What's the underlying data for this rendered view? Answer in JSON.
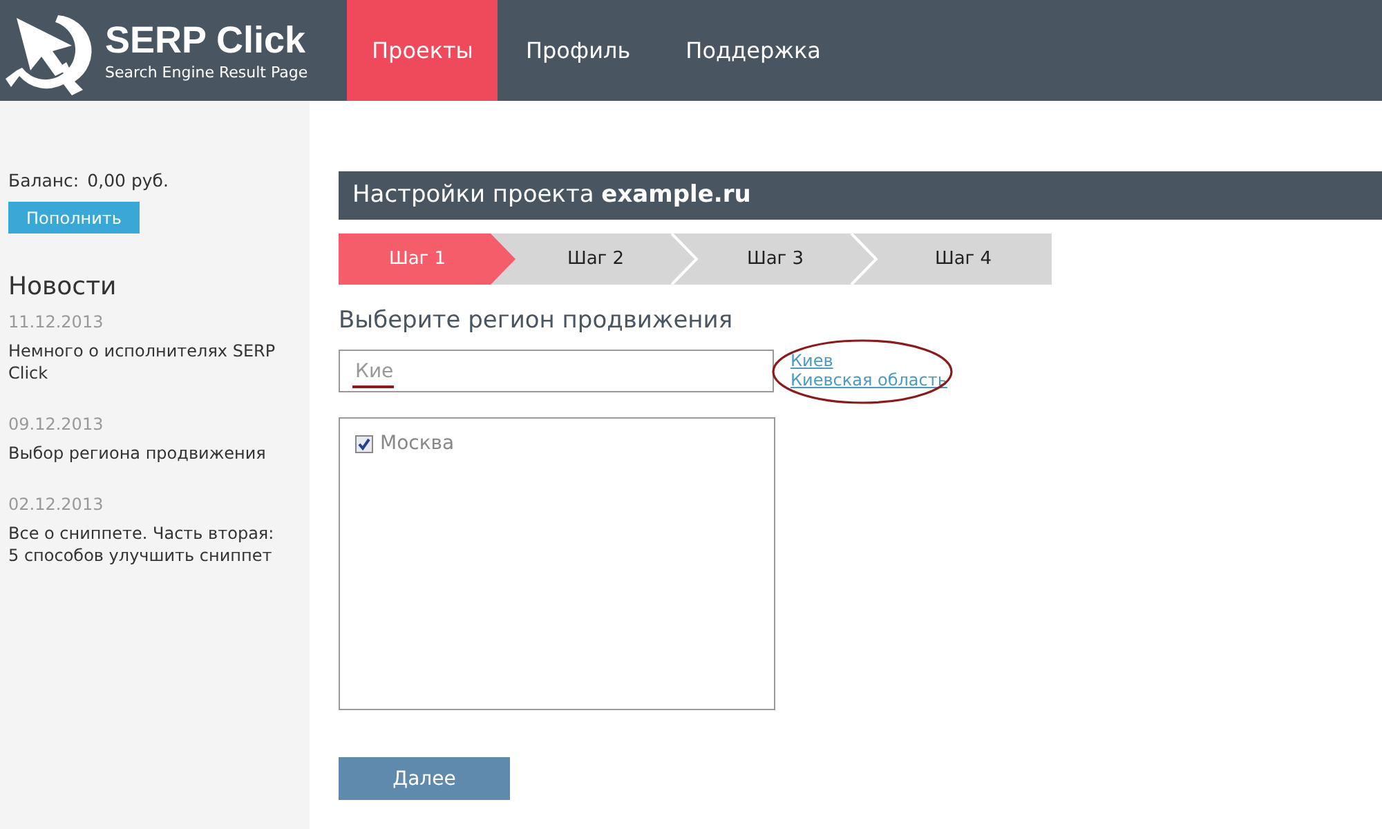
{
  "header": {
    "logo_title": "SERP Click",
    "logo_subtitle": "Search Engine Result Page",
    "nav": [
      {
        "label": "Проекты",
        "selected": true
      },
      {
        "label": "Профиль",
        "selected": false
      },
      {
        "label": "Поддержка",
        "selected": false
      }
    ]
  },
  "sidebar": {
    "balance_label": "Баланс:",
    "balance_value": "0,00 руб.",
    "topup_button": "Пополнить",
    "news_title": "Новости",
    "news": [
      {
        "date": "11.12.2013",
        "title": "Немного о исполнителях SERP Click"
      },
      {
        "date": "09.12.2013",
        "title": "Выбор региона продвижения"
      },
      {
        "date": "02.12.2013",
        "title": "Все о сниппете. Часть вторая: 5 способов улучшить сниппет"
      }
    ]
  },
  "main": {
    "title": "Настройки проекта **example.ru**",
    "steps": [
      {
        "label": "Шаг 1",
        "selected": true
      },
      {
        "label": "Шаг 2",
        "selected": false
      },
      {
        "label": "Шаг 3",
        "selected": false
      },
      {
        "label": "Шаг 4",
        "selected": false
      }
    ],
    "region_heading": "Выберите регион продвижения",
    "region_input": {
      "value": "Кие"
    },
    "suggestions": [
      "Киев",
      "Киевская область"
    ],
    "regions": [
      {
        "label": "Москва",
        "checked": true
      }
    ],
    "next_button": "Далее"
  }
}
